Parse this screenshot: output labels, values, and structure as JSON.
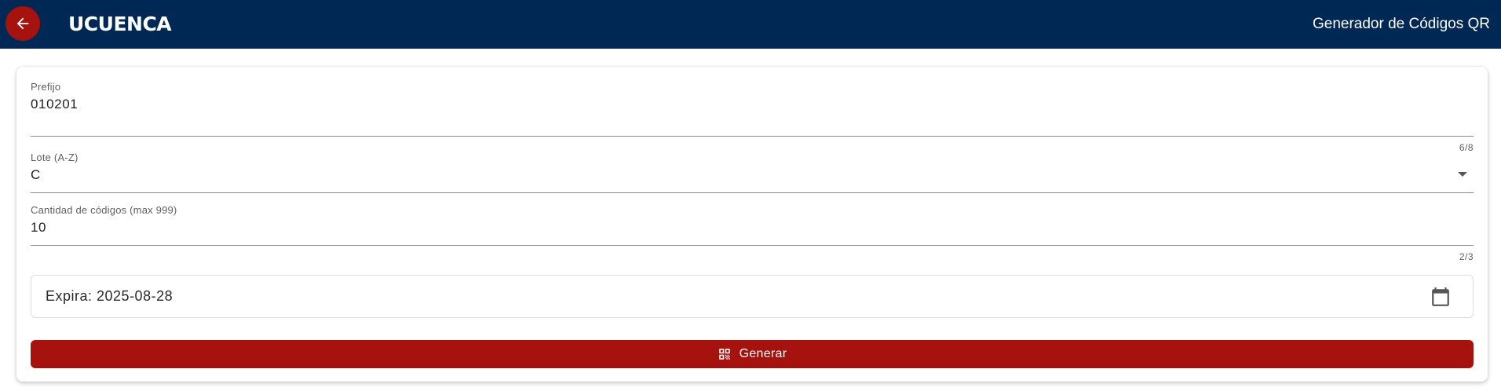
{
  "header": {
    "logo_text": "UCUENCA",
    "title": "Generador de Códigos QR",
    "back_icon": "arrow-left-icon"
  },
  "form": {
    "prefijo": {
      "label": "Prefijo",
      "value": "010201",
      "counter": "6/8"
    },
    "lote": {
      "label": "Lote (A-Z)",
      "value": "C",
      "icon": "dropdown-arrow-icon"
    },
    "cantidad": {
      "label": "Cantidad de códigos (max 999)",
      "value": "10",
      "counter": "2/3"
    },
    "expira": {
      "text": "Expira: 2025-08-28",
      "icon": "calendar-icon"
    },
    "generar": {
      "label": "Generar",
      "icon": "qr-code-icon"
    }
  },
  "colors": {
    "header_bg": "#002855",
    "accent_red": "#a6120d",
    "card_bg": "#ffffff"
  }
}
